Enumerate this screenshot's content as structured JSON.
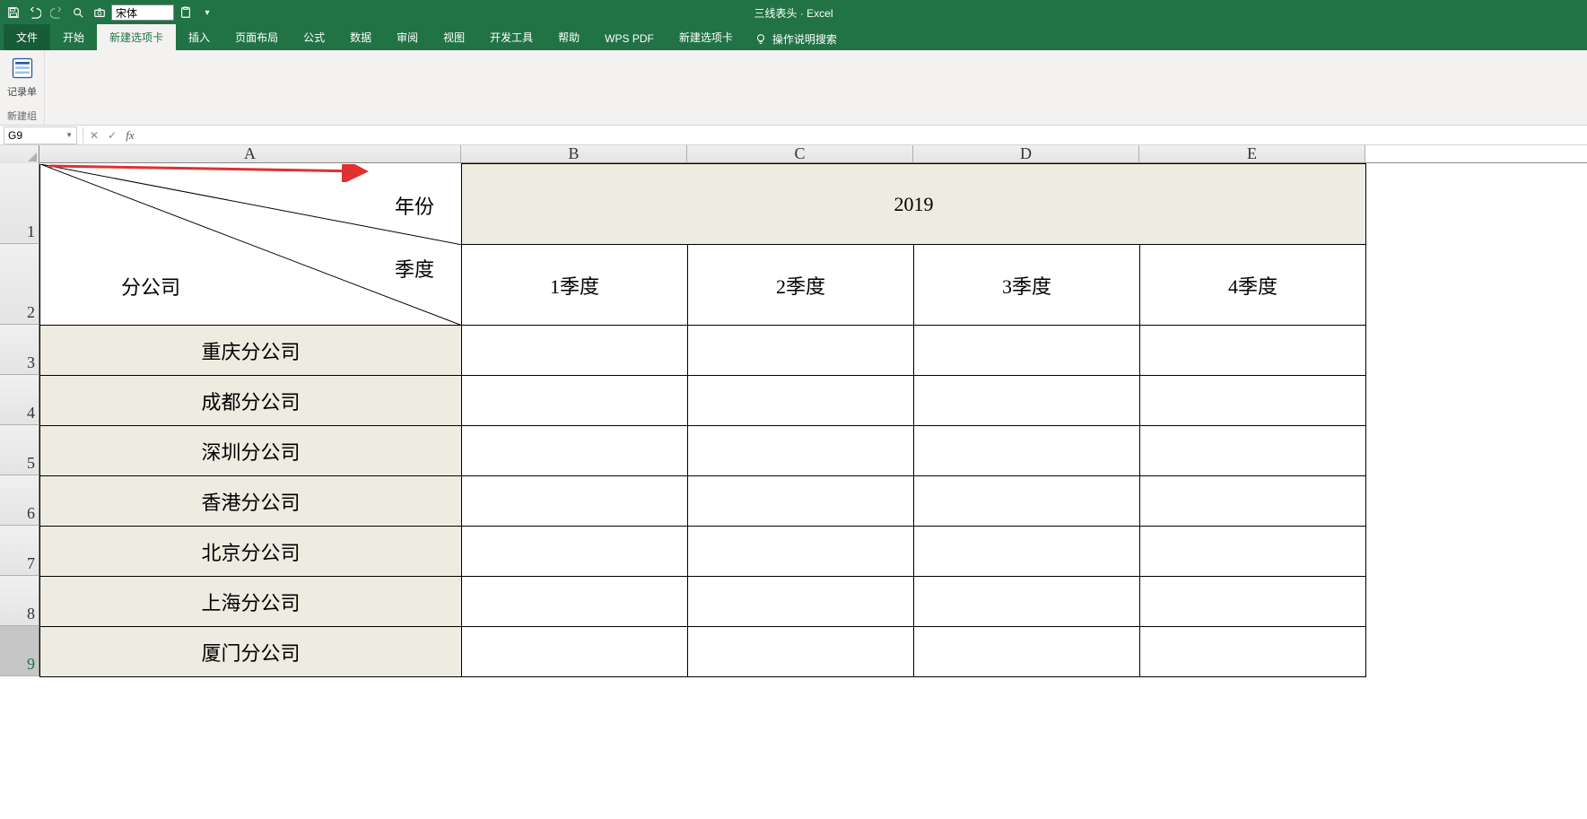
{
  "app": {
    "title": "三线表头 · Excel"
  },
  "qat": {
    "font_name": "宋体"
  },
  "tabs": {
    "file": "文件",
    "home": "开始",
    "custom": "新建选项卡",
    "insert": "插入",
    "layout": "页面布局",
    "formulas": "公式",
    "data": "数据",
    "review": "审阅",
    "view": "视图",
    "dev": "开发工具",
    "help": "帮助",
    "wps": "WPS PDF",
    "custom2": "新建选项卡",
    "tell_me": "操作说明搜索"
  },
  "ribbon": {
    "form_label": "记录单",
    "group_label": "新建组"
  },
  "formula": {
    "name_box": "G9",
    "cancel": "✕",
    "enter": "✓",
    "fx": "fx"
  },
  "columns": [
    "A",
    "B",
    "C",
    "D",
    "E"
  ],
  "rows": [
    "1",
    "2",
    "3",
    "4",
    "5",
    "6",
    "7",
    "8",
    "9"
  ],
  "header_cell": {
    "year_label": "年份",
    "quarter_label": "季度",
    "branch_label": "分公司"
  },
  "data": {
    "year": "2019",
    "quarters": [
      "1季度",
      "2季度",
      "3季度",
      "4季度"
    ],
    "branches": [
      "重庆分公司",
      "成都分公司",
      "深圳分公司",
      "香港分公司",
      "北京分公司",
      "上海分公司",
      "厦门分公司"
    ]
  },
  "row_heights": {
    "r1": 90,
    "r2": 90,
    "data_row": 56
  },
  "col_widths": {
    "a": 470,
    "std": 252
  }
}
